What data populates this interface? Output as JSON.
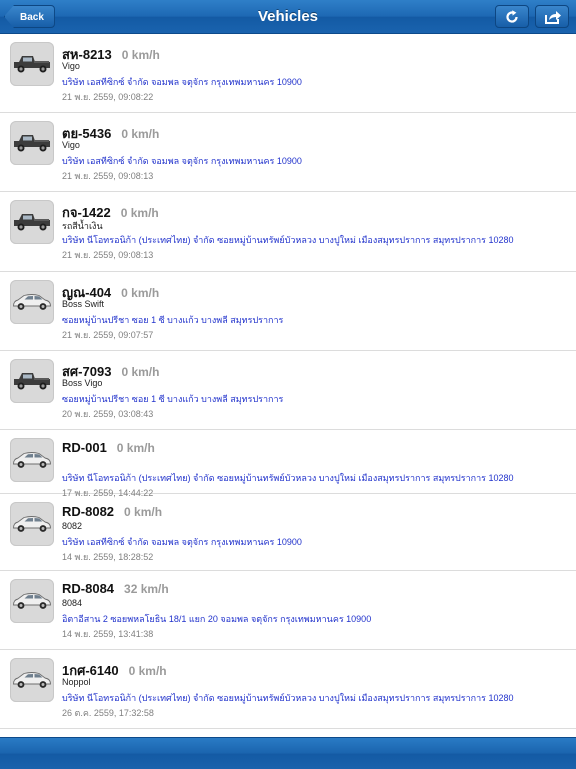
{
  "nav": {
    "title": "Vehicles",
    "back_label": "Back",
    "refresh_icon": "refresh-icon",
    "share_icon": "share-icon"
  },
  "vehicles": [
    {
      "plate": "สห-8213",
      "speed": "0 km/h",
      "model": "Vigo",
      "address": "บริษัท เอสทีซิกซ์ จำกัด จอมพล จตุจักร กรุงเทพมหานคร 10900",
      "time": "21 พ.ย. 2559, 09:08:22",
      "icon": "pickup-truck-icon"
    },
    {
      "plate": "ตย-5436",
      "speed": "0 km/h",
      "model": "Vigo",
      "address": "บริษัท เอสทีซิกซ์ จำกัด จอมพล จตุจักร กรุงเทพมหานคร 10900",
      "time": "21 พ.ย. 2559, 09:08:13",
      "icon": "pickup-truck-icon"
    },
    {
      "plate": "กจ-1422",
      "speed": "0 km/h",
      "model": "รถสีน้ำเงิน",
      "address": "บริษัท นีโอทรอนิก้า (ประเทศไทย) จำกัด ซอยหมู่บ้านทรัพย์บัวหลวง บางปูใหม่ เมืองสมุทรปราการ สมุทรปราการ 10280",
      "time": "21 พ.ย. 2559, 09:08:13",
      "icon": "pickup-truck-icon"
    },
    {
      "plate": "ญณ-404",
      "speed": "0 km/h",
      "model": "Boss Swift",
      "address": "ซอยหมู่บ้านปรีชา ซอย 1 ซี บางแก้ว บางพลี สมุทรปราการ",
      "time": "21 พ.ย. 2559, 09:07:57",
      "icon": "sedan-car-icon"
    },
    {
      "plate": "สศ-7093",
      "speed": "0 km/h",
      "model": "Boss Vigo",
      "address": "ซอยหมู่บ้านปรีชา ซอย 1 ซี บางแก้ว บางพลี สมุทรปราการ",
      "time": "20 พ.ย. 2559, 03:08:43",
      "icon": "pickup-truck-icon"
    },
    {
      "plate": "RD-001",
      "speed": "0 km/h",
      "model": "",
      "address": "บริษัท นีโอทรอนิก้า (ประเทศไทย) จำกัด ซอยหมู่บ้านทรัพย์บัวหลวง บางปูใหม่ เมืองสมุทรปราการ สมุทรปราการ 10280",
      "time": "17 พ.ย. 2559, 14:44:22",
      "icon": "sedan-car-icon"
    },
    {
      "plate": "RD-8082",
      "speed": "0 km/h",
      "model": "8082",
      "address": "บริษัท เอสทีซิกซ์ จำกัด จอมพล จตุจักร กรุงเทพมหานคร 10900",
      "time": "14 พ.ย. 2559, 18:28:52",
      "icon": "sedan-car-icon"
    },
    {
      "plate": "RD-8084",
      "speed": "32 km/h",
      "model": "8084",
      "address": "อิตาอีสาน 2 ซอยพหลโยธิน 18/1 แยก 20 จอมพล จตุจักร กรุงเทพมหานคร 10900",
      "time": "14 พ.ย. 2559, 13:41:38",
      "icon": "sedan-car-icon"
    },
    {
      "plate": "1กศ-6140",
      "speed": "0 km/h",
      "model": "Noppol",
      "address": "บริษัท นีโอทรอนิก้า (ประเทศไทย) จำกัด ซอยหมู่บ้านทรัพย์บัวหลวง บางปูใหม่ เมืองสมุทรปราการ สมุทรปราการ 10280",
      "time": "26 ต.ค. 2559, 17:32:58",
      "icon": "sedan-car-icon"
    }
  ]
}
